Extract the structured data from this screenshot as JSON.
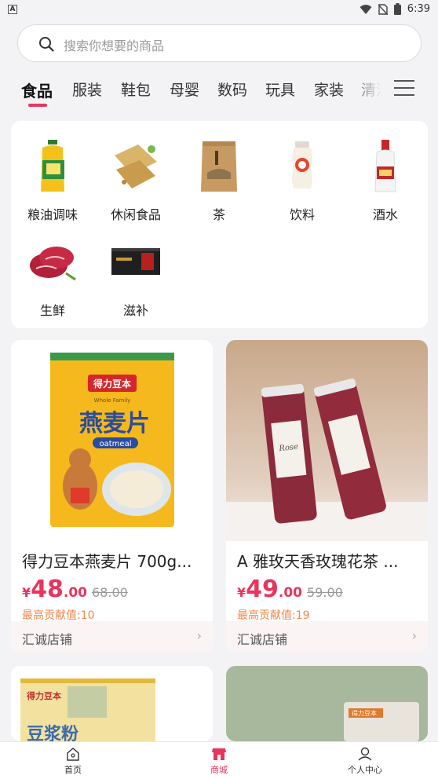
{
  "status_bar": {
    "time": "6:39",
    "app_badge": "A"
  },
  "search": {
    "placeholder": "搜索你想要的商品",
    "icon": "search-icon"
  },
  "category_tabs": [
    {
      "label": "食品",
      "active": true
    },
    {
      "label": "服装"
    },
    {
      "label": "鞋包"
    },
    {
      "label": "母婴"
    },
    {
      "label": "数码"
    },
    {
      "label": "玩具"
    },
    {
      "label": "家装"
    },
    {
      "label": "清洁"
    }
  ],
  "menu_icon": "hamburger-menu-icon",
  "subcategories": [
    {
      "label": "粮油调味",
      "icon": "cooking-oil-icon"
    },
    {
      "label": "休闲食品",
      "icon": "snack-crackers-icon"
    },
    {
      "label": "茶",
      "icon": "tea-bag-icon"
    },
    {
      "label": "饮料",
      "icon": "yogurt-drink-icon"
    },
    {
      "label": "酒水",
      "icon": "liquor-bottle-icon"
    },
    {
      "label": "生鲜",
      "icon": "fresh-meat-icon"
    },
    {
      "label": "滋补",
      "icon": "tonic-gift-box-icon"
    }
  ],
  "products": [
    {
      "title": "得力豆本燕麦片 700g...",
      "currency": "¥",
      "price_int": "48",
      "price_dec": ".00",
      "original_price": "68.00",
      "contribution": "最高贡献值:10",
      "shop": "汇诚店铺",
      "package_brand": "得力豆本",
      "package_sub": "Whole Family",
      "package_name": "燕麦片",
      "package_en": "oatmeal"
    },
    {
      "title": "A 雅玫天香玫瑰花茶 ...",
      "currency": "¥",
      "price_int": "49",
      "price_dec": ".00",
      "original_price": "59.00",
      "contribution": "最高贡献值:19",
      "shop": "汇诚店铺",
      "jar_label": "Rose"
    },
    {
      "package_brand": "得力豆本",
      "package_name": "豆浆粉"
    },
    {
      "package_brand": "得力豆本"
    }
  ],
  "bottom_nav": [
    {
      "label": "首页",
      "icon": "home-icon"
    },
    {
      "label": "商城",
      "icon": "store-icon",
      "active": true
    },
    {
      "label": "个人中心",
      "icon": "user-profile-icon"
    }
  ],
  "colors": {
    "accent": "#e8355d",
    "contribution": "#f0874a",
    "background": "#f3f3f5"
  }
}
